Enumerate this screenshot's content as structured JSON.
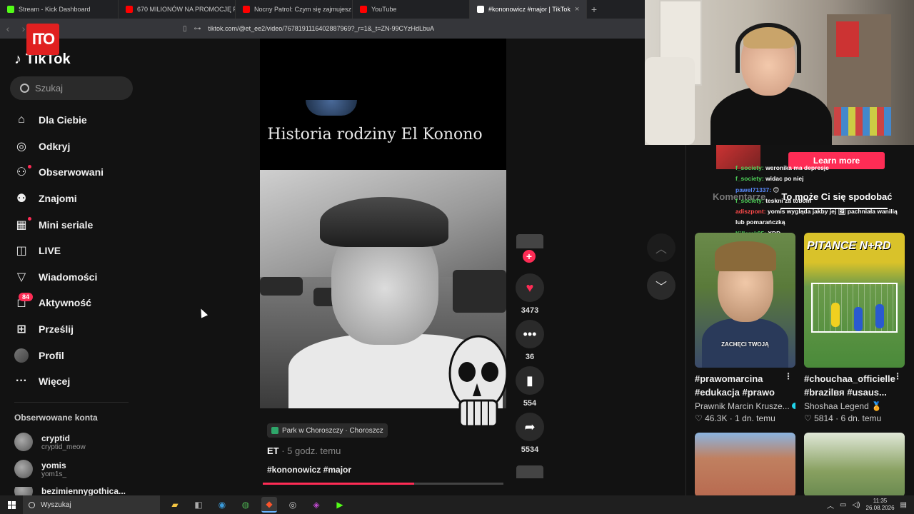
{
  "browser": {
    "tabs": [
      {
        "title": "Stream - Kick Dashboard",
        "color": "#53fc18"
      },
      {
        "title": "670 MILIONÓW NA PROMOCJĘ POL...",
        "color": "#ff0000"
      },
      {
        "title": "Nocny Patrol: Czym się zajmujesz i ile...",
        "color": "#ff0000"
      },
      {
        "title": "YouTube",
        "color": "#ff0000"
      },
      {
        "title": "#kononowicz #major | TikTok",
        "color": "#ffffff"
      }
    ],
    "url": "tiktok.com/@et_ee2/video/7678191116402887969?_r=1&_t=ZN-99CYzHdLbuA"
  },
  "overlay_logo": "ITO",
  "tiktok": {
    "logo": "TikTok",
    "search_placeholder": "Szukaj",
    "nav": [
      {
        "label": "Dla Ciebie",
        "icon": "home-icon",
        "glyph": "⌂"
      },
      {
        "label": "Odkryj",
        "icon": "compass-icon",
        "glyph": "◎"
      },
      {
        "label": "Obserwowani",
        "icon": "following-icon",
        "glyph": "⚇"
      },
      {
        "label": "Znajomi",
        "icon": "friends-icon",
        "glyph": "⚉"
      },
      {
        "label": "Mini seriale",
        "icon": "mini-series-icon",
        "glyph": "▦"
      },
      {
        "label": "LIVE",
        "icon": "live-icon",
        "glyph": "◫"
      },
      {
        "label": "Wiadomości",
        "icon": "messages-icon",
        "glyph": "▽"
      },
      {
        "label": "Aktywność",
        "icon": "activity-icon",
        "glyph": "◻",
        "badge": "84"
      },
      {
        "label": "Prześlij",
        "icon": "upload-icon",
        "glyph": "⊞"
      },
      {
        "label": "Profil",
        "icon": "profile-avatar",
        "glyph": ""
      },
      {
        "label": "Więcej",
        "icon": "more-icon",
        "glyph": "···"
      }
    ],
    "followed_title": "Obserwowane konta",
    "followed": [
      {
        "name": "cryptid",
        "user": "cryptid_meow"
      },
      {
        "name": "yomis",
        "user": "yom1s_"
      },
      {
        "name": "bezimiennygothica...",
        "user": ""
      }
    ]
  },
  "video": {
    "headline": "Historia rodziny El Konono",
    "location": "Park w Choroszczy · Choroszcz",
    "author": "ET",
    "time": " · 5 godz. temu",
    "tags": "#kononowicz #major",
    "progress": 0.63,
    "likes": "3473",
    "comments": "36",
    "saves": "554",
    "shares": "5534"
  },
  "right": {
    "tabs": [
      "Komentarze",
      "To może Ci się spodobać"
    ],
    "learn_more": "Learn more",
    "chat": [
      {
        "user": "f_society:",
        "msg": "weronika ma depresje",
        "color": "#4fd35a"
      },
      {
        "user": "f_society:",
        "msg": "widac po niej",
        "color": "#4fd35a"
      },
      {
        "user": "pawel71337:",
        "msg": "😊",
        "color": "#5a8cff"
      },
      {
        "user": "f_society:",
        "msg": "teskni za tobom",
        "color": "#4fd35a"
      },
      {
        "user": "adiszpont:",
        "msg": "yomis wygląda jakby jej 🖼 pachniała wanilią lub pomarańczką",
        "color": "#ff4a4a"
      },
      {
        "user": "Killerek95:",
        "msg": "XDD",
        "color": "#4fd35a"
      }
    ],
    "cards": [
      {
        "title": "#prawomarcina #edukacja #prawo",
        "author": "Prawnik Marcin Krusze...",
        "likes": "46.3K",
        "time": "1 dn. temu",
        "caption": "ZACHĘCI TWOJĄ"
      },
      {
        "title": "#chouchaa_officielle #brazilвя #usaus...",
        "author": "Shoshaa Legend 🏅",
        "likes": "5814",
        "time": "6 dn. temu",
        "caption": "PITANCE N+RD"
      }
    ]
  },
  "taskbar": {
    "search": "Wyszukaj",
    "time": "11:35",
    "date": "26.08.2026"
  }
}
